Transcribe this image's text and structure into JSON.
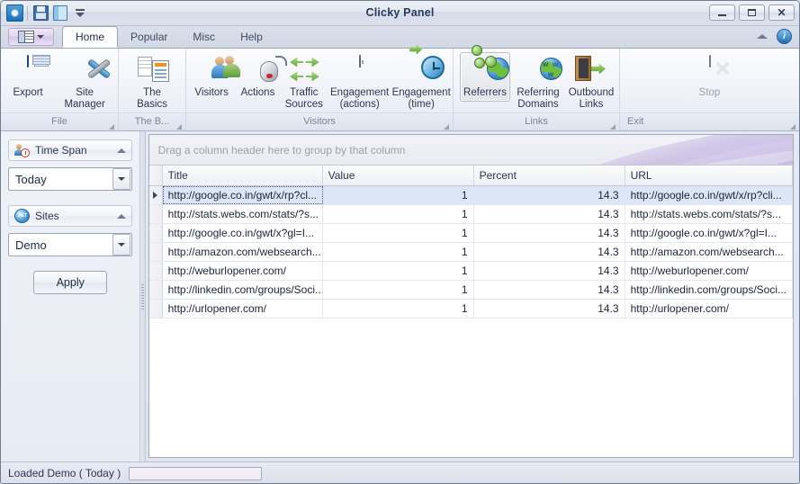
{
  "window": {
    "title": "Clicky Panel",
    "controls": {
      "minimize": "–",
      "maximize": "□",
      "close": "✕"
    }
  },
  "quick_access": {
    "items": [
      {
        "name": "app-icon",
        "label": "Clicky"
      },
      {
        "name": "save-icon",
        "label": "Save"
      },
      {
        "name": "open-panel-icon",
        "label": "Panel"
      },
      {
        "name": "customize-qat-icon",
        "label": "Customize Quick Access Toolbar"
      }
    ]
  },
  "tabs": {
    "app_menu_label": "",
    "items": [
      {
        "label": "Home",
        "active": true
      },
      {
        "label": "Popular",
        "active": false
      },
      {
        "label": "Misc",
        "active": false
      },
      {
        "label": "Help",
        "active": false
      }
    ],
    "right_icons": [
      {
        "name": "collapse-ribbon-icon",
        "label": "^"
      },
      {
        "name": "help-info-icon",
        "label": "i"
      }
    ]
  },
  "ribbon": {
    "groups": [
      {
        "caption": "File",
        "buttons": [
          {
            "label": "Export",
            "icon": "export-icon",
            "state": "normal"
          },
          {
            "label": "Site Manager",
            "icon": "tools-icon",
            "state": "normal"
          }
        ]
      },
      {
        "caption": "The B...",
        "buttons": [
          {
            "label": "The Basics",
            "icon": "documents-icon",
            "state": "normal"
          }
        ]
      },
      {
        "caption": "Visitors",
        "buttons": [
          {
            "label": "Visitors",
            "icon": "users-icon",
            "state": "normal"
          },
          {
            "label": "Actions",
            "icon": "mouse-icon",
            "state": "normal"
          },
          {
            "label": "Traffic\nSources",
            "icon": "arrows-icon",
            "state": "normal"
          },
          {
            "label": "Engagement\n(actions)",
            "icon": "chart-icon",
            "state": "normal"
          },
          {
            "label": "Engagement\n(time)",
            "icon": "clock-icon",
            "state": "normal"
          }
        ]
      },
      {
        "caption": "Links",
        "buttons": [
          {
            "label": "Referrers",
            "icon": "network-globe-icon",
            "state": "selected"
          },
          {
            "label": "Referring\nDomains",
            "icon": "web-globe-icon",
            "state": "normal"
          },
          {
            "label": "Outbound\nLinks",
            "icon": "door-exit-icon",
            "state": "normal"
          }
        ]
      },
      {
        "caption": "Exit",
        "buttons": [
          {
            "label": "Stop",
            "icon": "stop-icon",
            "state": "disabled"
          }
        ]
      }
    ]
  },
  "sidebar": {
    "time_span": {
      "title": "Time Span",
      "icon": "time-span-icon",
      "value": "Today"
    },
    "sites": {
      "title": "Sites",
      "icon": "dotnet-globe-icon",
      "value": "Demo"
    },
    "apply_label": "Apply"
  },
  "grid": {
    "group_hint": "Drag a column header here to group by that column",
    "columns": [
      "Title",
      "Value",
      "Percent",
      "URL"
    ],
    "rows": [
      {
        "selected": true,
        "title": "http://google.co.in/gwt/x/rp?cl...",
        "value": "1",
        "percent": "14.3",
        "url": "http://google.co.in/gwt/x/rp?cli..."
      },
      {
        "selected": false,
        "title": "http://stats.webs.com/stats/?s...",
        "value": "1",
        "percent": "14.3",
        "url": "http://stats.webs.com/stats/?s..."
      },
      {
        "selected": false,
        "title": "http://google.co.in/gwt/x?gl=I...",
        "value": "1",
        "percent": "14.3",
        "url": "http://google.co.in/gwt/x?gl=I..."
      },
      {
        "selected": false,
        "title": "http://amazon.com/websearch...",
        "value": "1",
        "percent": "14.3",
        "url": "http://amazon.com/websearch..."
      },
      {
        "selected": false,
        "title": "http://weburlopener.com/",
        "value": "1",
        "percent": "14.3",
        "url": "http://weburlopener.com/"
      },
      {
        "selected": false,
        "title": "http://linkedin.com/groups/Soci...",
        "value": "1",
        "percent": "14.3",
        "url": "http://linkedin.com/groups/Soci..."
      },
      {
        "selected": false,
        "title": "http://urlopener.com/",
        "value": "1",
        "percent": "14.3",
        "url": "http://urlopener.com/"
      }
    ]
  },
  "status": {
    "text": "Loaded Demo ( Today )",
    "progress_percent": 100
  },
  "colors": {
    "window_border": "#6f7d92",
    "title_text": "#243a5e",
    "selection": "#dde6f7",
    "progress": "#e0bff2",
    "accent_purple": "#b6a8cb"
  }
}
